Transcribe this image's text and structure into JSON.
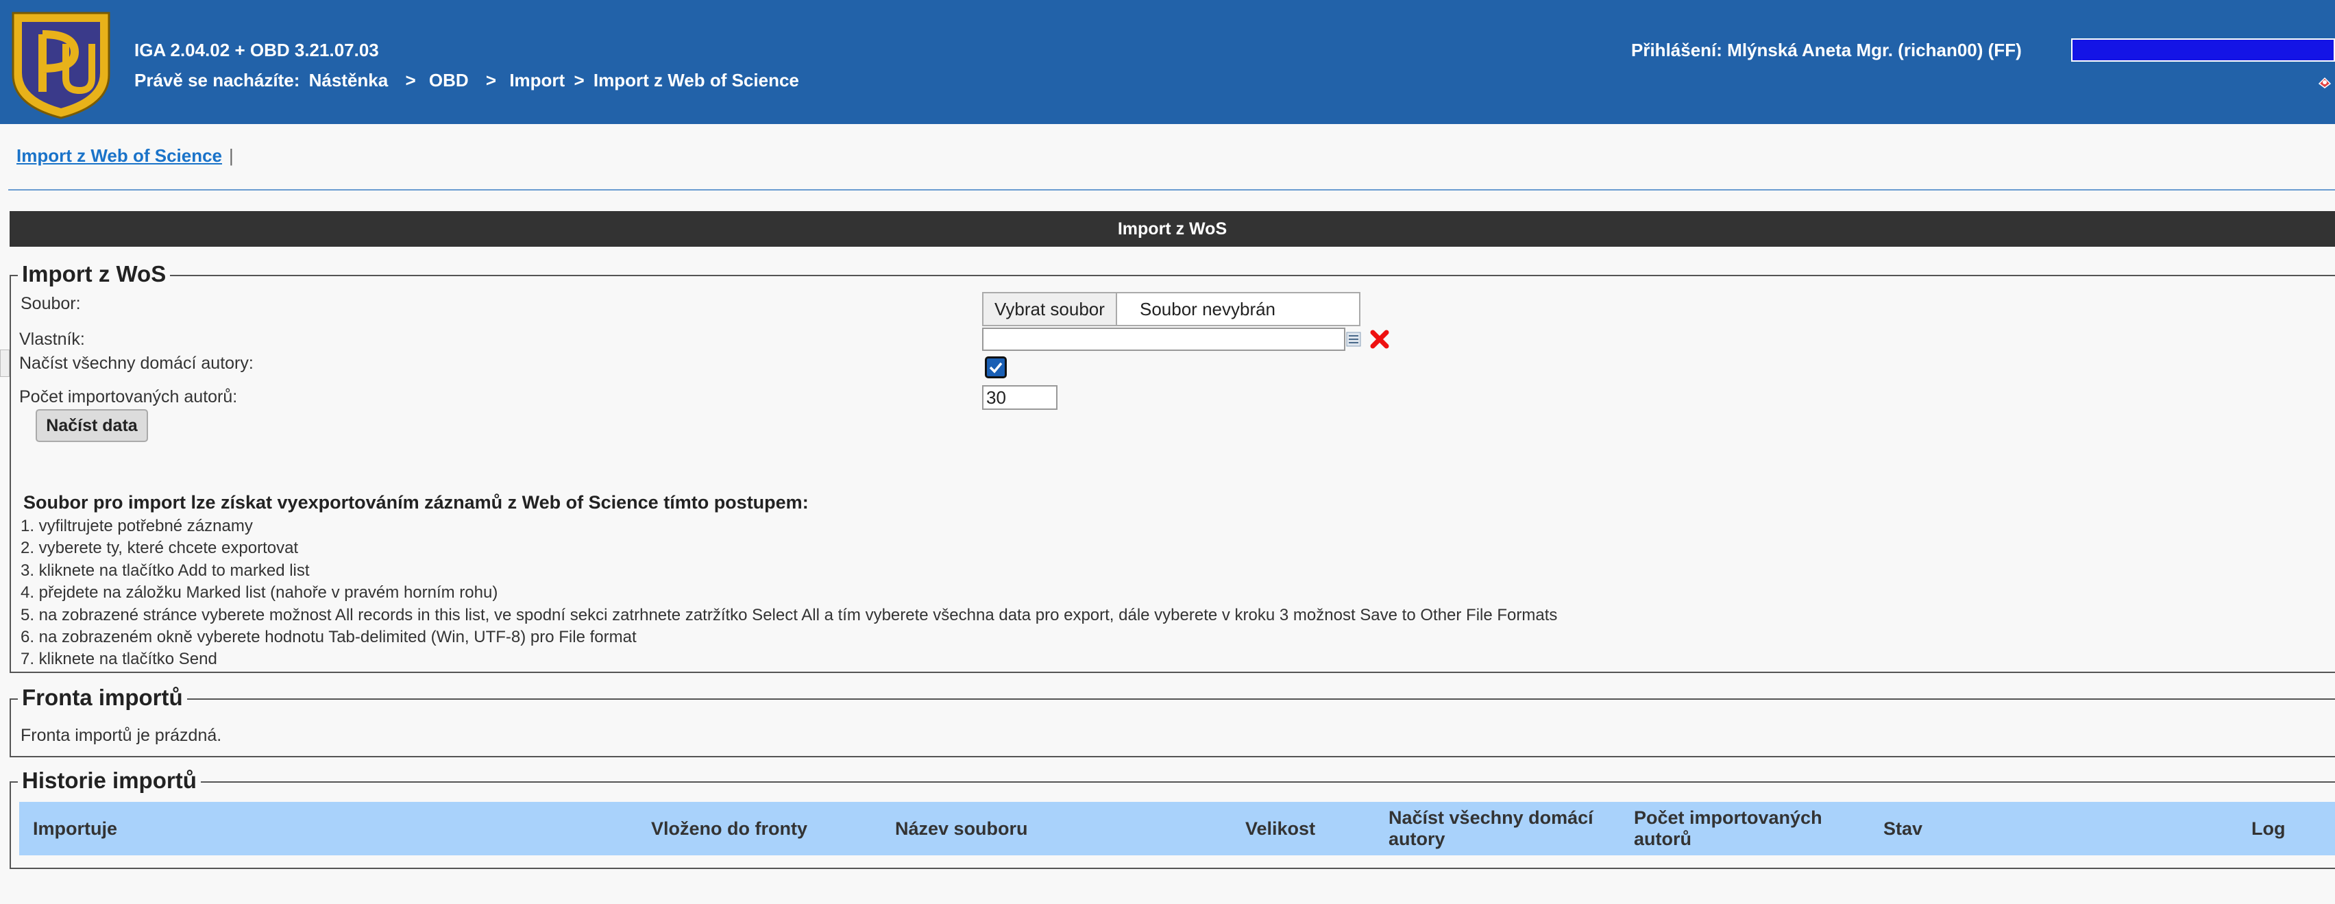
{
  "header": {
    "version": "IGA 2.04.02 + OBD 3.21.07.03",
    "location_prefix": "Právě se nacházíte:",
    "breadcrumb": [
      "Nástěnka",
      ">",
      "OBD",
      ">",
      "Import",
      ">",
      "Import z Web of Science"
    ],
    "login_label": "Přihlášení:",
    "login_user": "Mlýnská Aneta Mgr. (richan00) (FF)",
    "brand_color": "#2262a9"
  },
  "tabs": {
    "active_tab": "Import z Web of Science",
    "separator": "|"
  },
  "section_title": "Import z WoS",
  "import_form": {
    "legend": "Import z WoS",
    "file_label": "Soubor:",
    "file_button": "Vybrat soubor",
    "file_status": "Soubor nevybrán",
    "owner_label": "Vlastník:",
    "owner_value": "",
    "load_all_label": "Načíst všechny domácí autory:",
    "load_all_checked": true,
    "count_label": "Počet importovaných autorů:",
    "count_value": "30",
    "load_button": "Načíst data",
    "instructions_title": "Soubor pro import lze získat vyexportováním záznamů z Web of Science tímto postupem:",
    "instructions": [
      "1. vyfiltrujete potřebné záznamy",
      "2. vyberete ty, které chcete exportovat",
      "3. kliknete na tlačítko Add to marked list",
      "4. přejdete na záložku Marked list (nahoře v pravém horním rohu)",
      "5. na zobrazené stránce vyberete možnost All records in this list, ve spodní sekci zatrhnete zatržítko Select All a tím vyberete všechna data pro export, dále vyberete v kroku 3 možnost Save to Other File Formats",
      "6. na zobrazeném okně vyberete hodnotu Tab-delimited (Win, UTF-8) pro File format",
      "7. kliknete na tlačítko Send"
    ]
  },
  "queue": {
    "legend": "Fronta importů",
    "empty_text": "Fronta importů je prázdná."
  },
  "history": {
    "legend": "Historie importů",
    "columns": [
      "Importuje",
      "Vloženo do fronty",
      "Název souboru",
      "Velikost",
      "Načíst všechny domácí autory",
      "Počet importovaných autorů",
      "Stav",
      "Log"
    ],
    "header_color": "#a9d2fb"
  }
}
